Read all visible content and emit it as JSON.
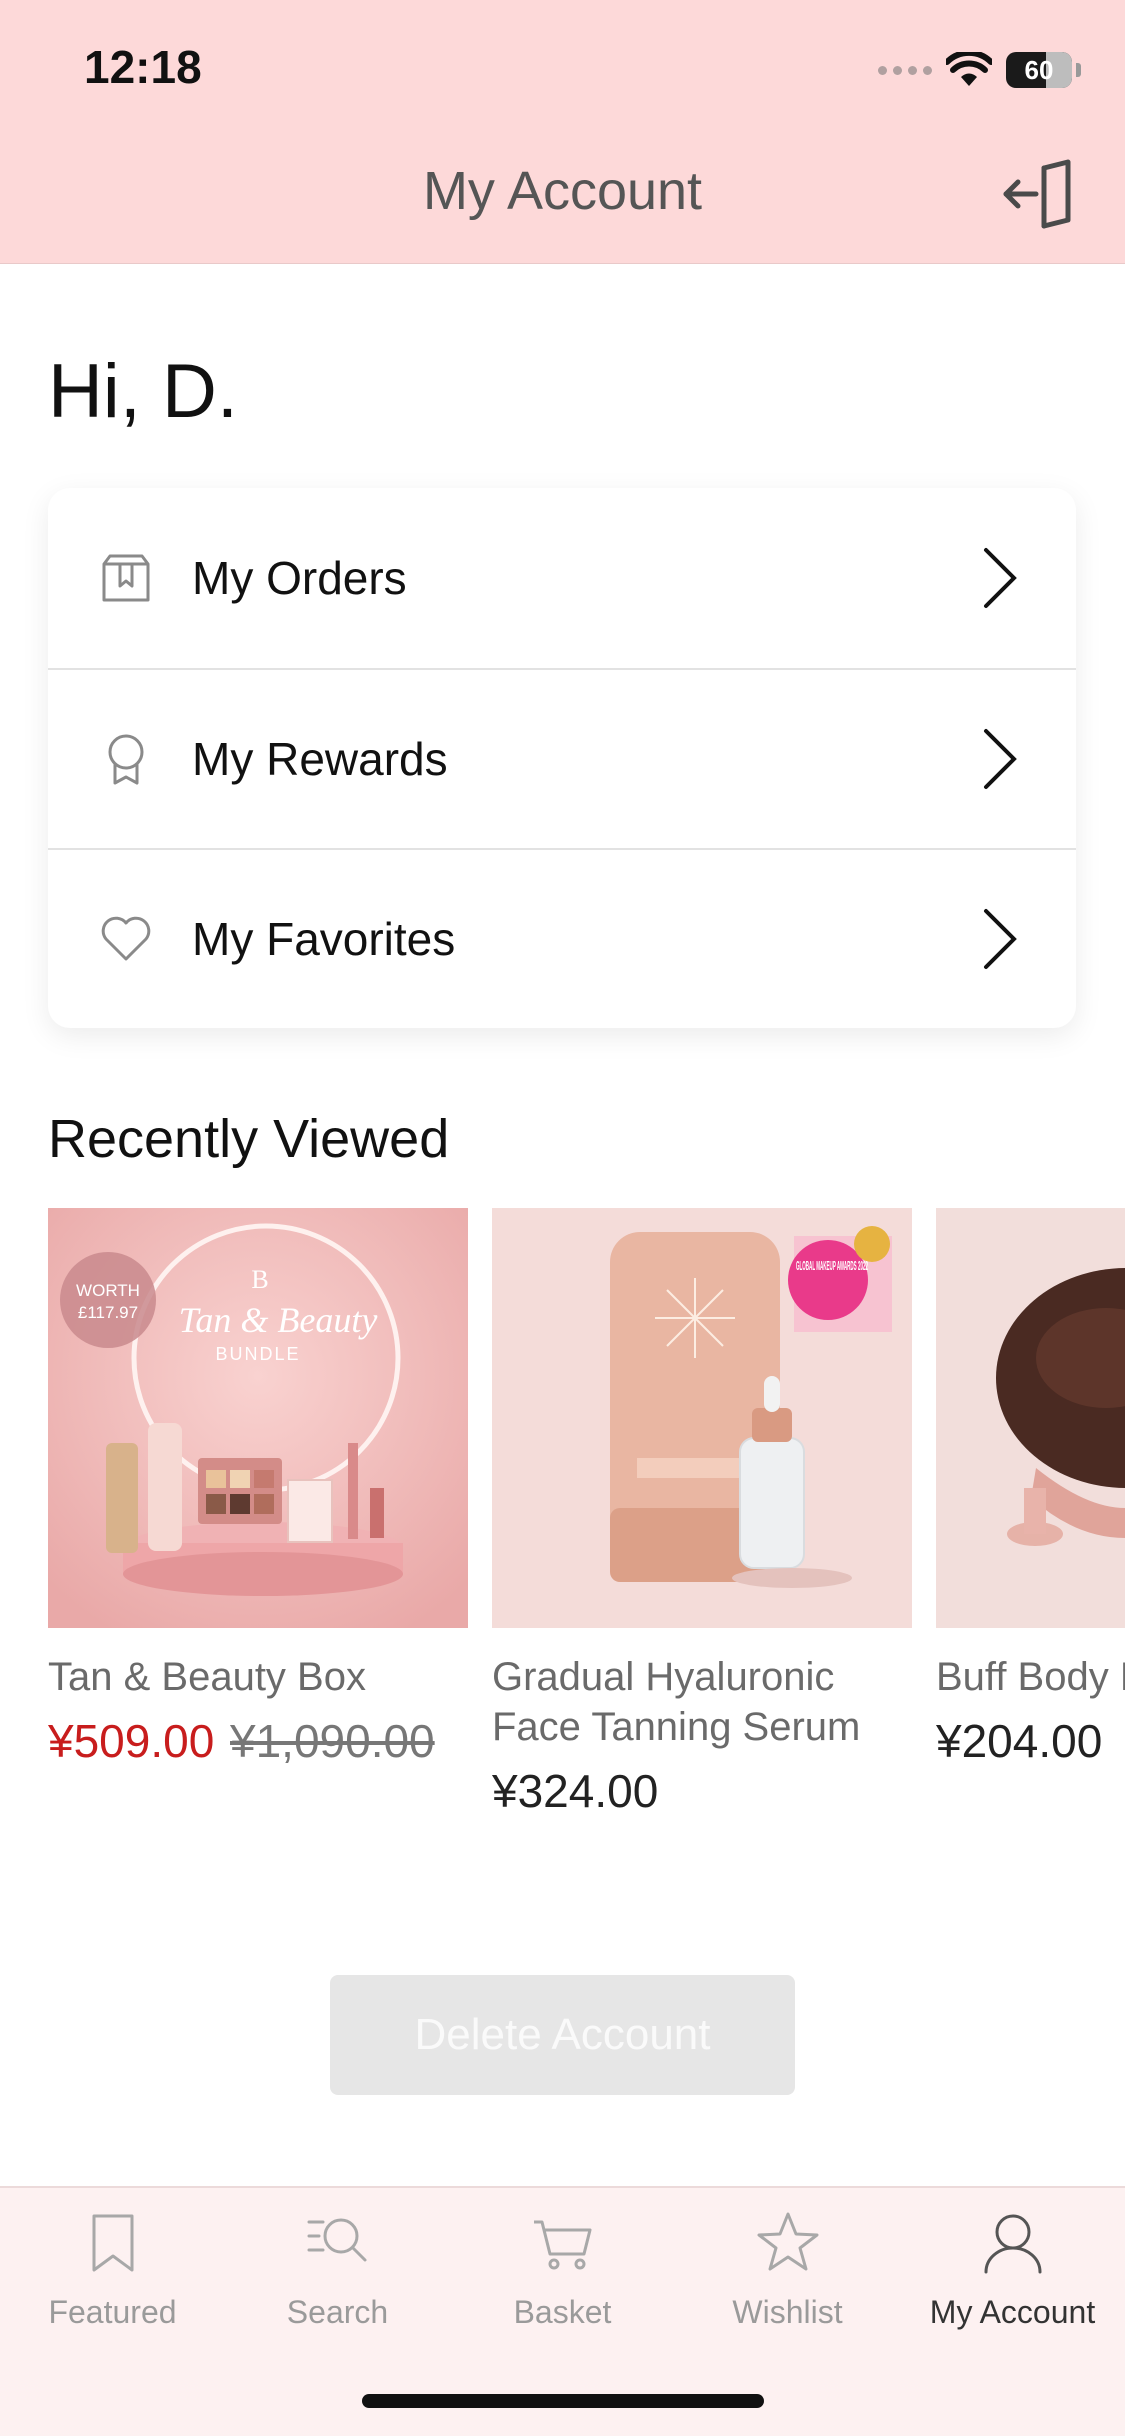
{
  "status_bar": {
    "time": "12:18",
    "battery": "60"
  },
  "header": {
    "title": "My Account",
    "logout_icon": "logout-icon"
  },
  "greeting": "Hi,  D.",
  "menu": [
    {
      "label": "My Orders",
      "icon": "box-icon"
    },
    {
      "label": "My Rewards",
      "icon": "award-icon"
    },
    {
      "label": "My Favorites",
      "icon": "heart-icon"
    }
  ],
  "recently_viewed": {
    "title": "Recently Viewed",
    "products": [
      {
        "name": "Tan & Beauty Box",
        "sale_price": "¥509.00",
        "original_price": "¥1,090.00",
        "badge_text": "WORTH",
        "badge_value": "£117.97",
        "image_line1": "Tan & Beauty",
        "image_line2": "BUNDLE",
        "image_logo": "B"
      },
      {
        "name": "Gradual Hyaluronic Face Tanning Serum",
        "price": "¥324.00",
        "award_text": "GLOBAL MAKEUP AWARDS 2022"
      },
      {
        "name": "Buff Body B",
        "price": "¥204.00"
      }
    ]
  },
  "delete_account": "Delete Account",
  "tabs": [
    {
      "label": "Featured",
      "icon": "bookmark-icon",
      "active": false
    },
    {
      "label": "Search",
      "icon": "search-icon",
      "active": false
    },
    {
      "label": "Basket",
      "icon": "cart-icon",
      "active": false
    },
    {
      "label": "Wishlist",
      "icon": "star-icon",
      "active": false
    },
    {
      "label": "My Account",
      "icon": "user-icon",
      "active": true
    }
  ],
  "colors": {
    "header_bg": "#fdd9d9",
    "sale_red": "#c81d1d",
    "tabbar_bg": "#fdf1f1"
  }
}
